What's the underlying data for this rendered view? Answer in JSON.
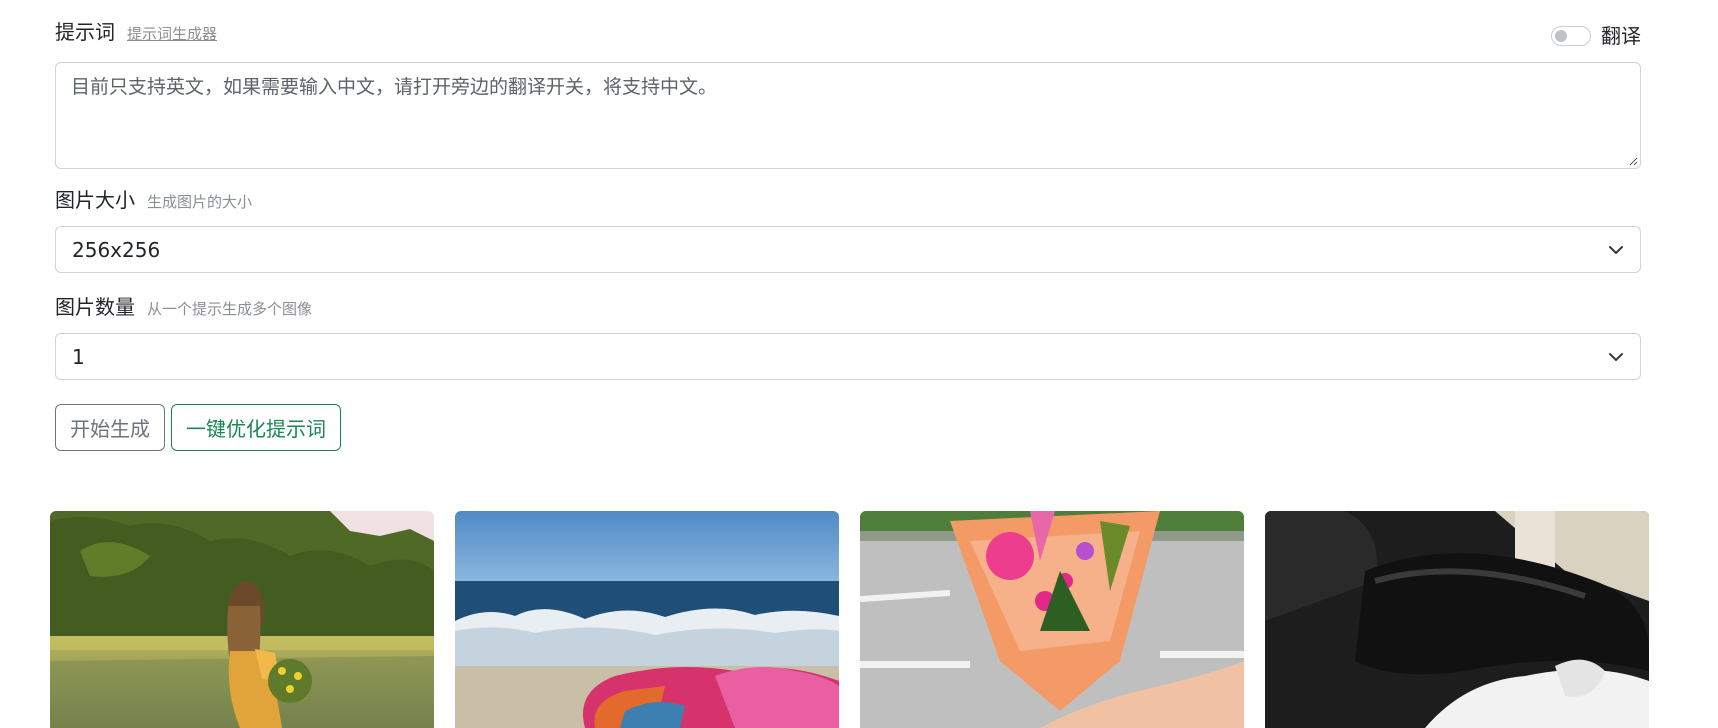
{
  "prompt": {
    "label": "提示词",
    "generator_link": "提示词生成器",
    "translate_label": "翻译",
    "translate_on": false,
    "placeholder": "目前只支持英文，如果需要输入中文，请打开旁边的翻译开关，将支持中文。"
  },
  "image_size": {
    "label": "图片大小",
    "hint": "生成图片的大小",
    "value": "256x256"
  },
  "image_count": {
    "label": "图片数量",
    "hint": "从一个提示生成多个图像",
    "value": "1"
  },
  "buttons": {
    "generate": "开始生成",
    "optimize": "一键优化提示词"
  },
  "gallery": {
    "images": [
      {
        "name": "girl-in-meadow-image"
      },
      {
        "name": "beach-towel-image"
      },
      {
        "name": "flower-bouquet-image"
      },
      {
        "name": "cat-on-couch-image"
      }
    ]
  }
}
